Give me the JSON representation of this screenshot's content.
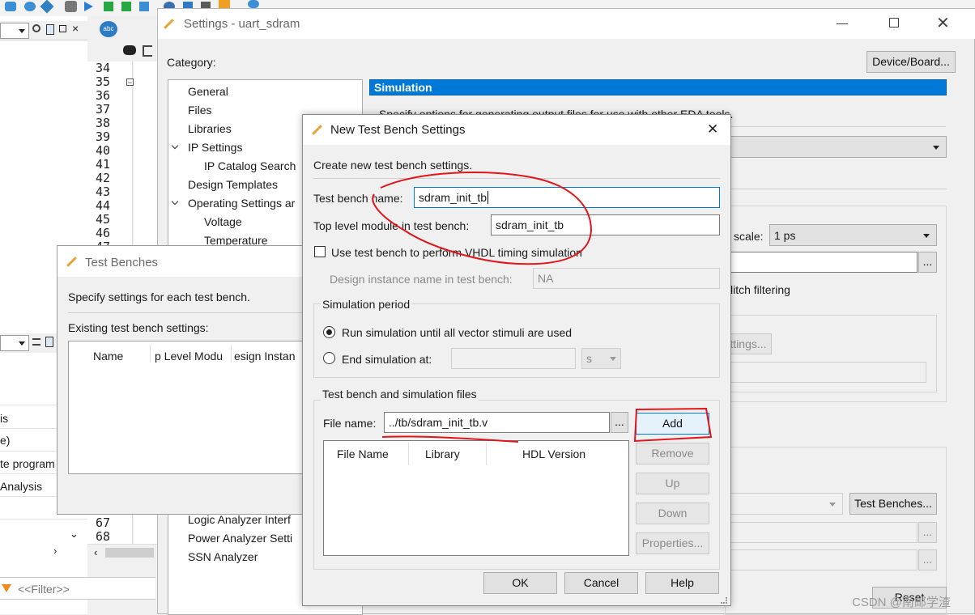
{
  "main_settings": {
    "title": "Settings - uart_sdram",
    "category_label": "Category:",
    "device_button": "Device/Board...",
    "categories": [
      {
        "label": "General",
        "indent": 0,
        "arrow": ""
      },
      {
        "label": "Files",
        "indent": 0,
        "arrow": ""
      },
      {
        "label": "Libraries",
        "indent": 0,
        "arrow": ""
      },
      {
        "label": "IP Settings",
        "indent": 0,
        "arrow": "v"
      },
      {
        "label": "IP Catalog Search",
        "indent": 1,
        "arrow": ""
      },
      {
        "label": "Design Templates",
        "indent": 0,
        "arrow": ""
      },
      {
        "label": "Operating Settings ar",
        "indent": 0,
        "arrow": "v"
      },
      {
        "label": "Voltage",
        "indent": 1,
        "arrow": ""
      },
      {
        "label": "Temperature",
        "indent": 1,
        "arrow": ""
      }
    ],
    "categories_bottom": [
      "Logic Analyzer Interf",
      "Power Analyzer Setti",
      "SSN Analyzer"
    ],
    "panel_header": "Simulation",
    "panel_description": "Specify options for generating output files for use with other EDA tools.",
    "time_scale_label": "scale:",
    "time_scale_value": "1 ps",
    "glitch_label": "litch filtering",
    "settings_button_partial": "ttings...",
    "test_benches_button": "Test Benches...",
    "reset_button": "Reset"
  },
  "code_editor": {
    "lines_top": [
      "34",
      "35",
      "36",
      "37",
      "38",
      "39",
      "40",
      "41",
      "42",
      "43",
      "44",
      "45",
      "46",
      "47"
    ],
    "lines_bottom": [
      "67",
      "68"
    ]
  },
  "left_panel": {
    "items": [
      "is",
      "e)",
      "te program",
      "Analysis"
    ],
    "filter_placeholder": "<<Filter>>"
  },
  "test_benches_dialog": {
    "title": "Test Benches",
    "description": "Specify settings for each test bench.",
    "existing_label": "Existing test bench settings:",
    "columns": [
      "Name",
      "p Level Modu",
      "esign Instan"
    ]
  },
  "new_tb_dialog": {
    "title": "New Test Bench Settings",
    "close_glyph": "✕",
    "description": "Create new test bench settings.",
    "tb_name_label": "Test bench name:",
    "tb_name_value": "sdram_init_tb",
    "top_module_label": "Top level module in test bench:",
    "top_module_value": "sdram_init_tb",
    "vhdl_checkbox_label": "Use test bench to perform VHDL timing simulation",
    "design_instance_label": "Design instance name in test bench:",
    "design_instance_value": "NA",
    "sim_period_title": "Simulation period",
    "radio_run_all": "Run simulation until all vector stimuli are used",
    "radio_end_at": "End simulation at:",
    "end_unit": "s",
    "files_group_title": "Test bench and simulation files",
    "file_name_label": "File name:",
    "file_name_value": "../tb/sdram_init_tb.v",
    "browse_glyph": "...",
    "add_button": "Add",
    "remove_button": "Remove",
    "up_button": "Up",
    "down_button": "Down",
    "properties_button": "Properties...",
    "file_columns": [
      "File Name",
      "Library",
      "HDL Version"
    ],
    "ok_button": "OK",
    "cancel_button": "Cancel",
    "help_button": "Help"
  },
  "watermark": "CSDN @南邮学渣",
  "colors": {
    "accent": "#0078d7",
    "annotation": "#e0161b",
    "header_bg": "#0078d7"
  }
}
